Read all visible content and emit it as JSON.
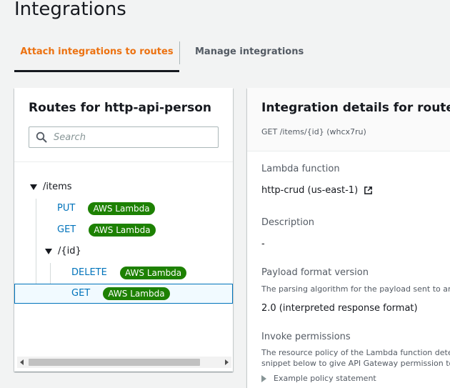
{
  "page": {
    "title": "Integrations"
  },
  "tabs": [
    {
      "label": "Attach integrations to routes",
      "active": true
    },
    {
      "label": "Manage integrations",
      "active": false
    }
  ],
  "routes_panel": {
    "title": "Routes for http-api-person",
    "search_placeholder": "Search",
    "tree": [
      {
        "path": "/items"
      },
      {
        "method": "PUT",
        "badge": "AWS Lambda"
      },
      {
        "method": "GET",
        "badge": "AWS Lambda"
      },
      {
        "path": "/{id}"
      },
      {
        "method": "DELETE",
        "badge": "AWS Lambda"
      },
      {
        "method": "GET",
        "badge": "AWS Lambda",
        "selected": true
      }
    ]
  },
  "details_panel": {
    "title": "Integration details for route",
    "subtitle": "GET /items/{id} (whcx7ru)",
    "lambda_label": "Lambda function",
    "lambda_value": "http-crud (us-east-1)",
    "description_label": "Description",
    "description_value": "-",
    "payload_label": "Payload format version",
    "payload_desc": "The parsing algorithm for the payload sent to ar",
    "payload_value": "2.0 (interpreted response format)",
    "invoke_label": "Invoke permissions",
    "invoke_desc_1": "The resource policy of the Lambda function dete",
    "invoke_desc_2": "snippet below to give API Gateway permission to",
    "example_label": "Example policy statement"
  },
  "colors": {
    "accent": "#ec7211",
    "link": "#0073bb",
    "badge": "#1d8102"
  },
  "icons": [
    "search-icon",
    "external-link-icon",
    "caret-down-icon",
    "caret-right-icon"
  ]
}
